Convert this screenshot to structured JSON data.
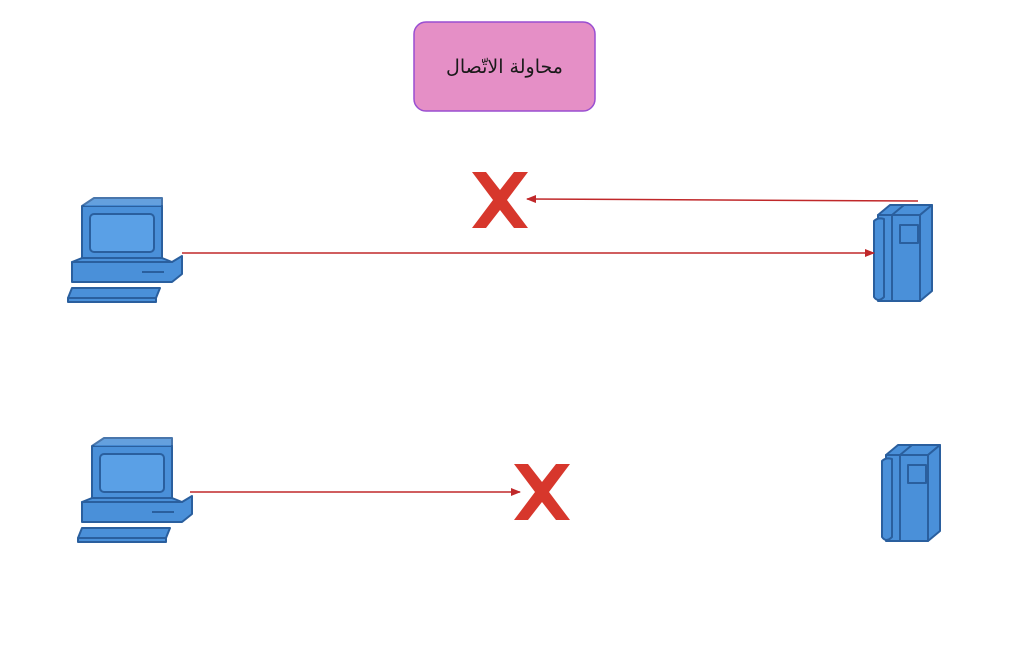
{
  "title": {
    "text": "محاولة الاتّصال",
    "fill": "#E58FC6",
    "border": "#9A4FD1",
    "text_color": "#1A1A1A"
  },
  "colors": {
    "device_fill": "#4A90D9",
    "device_stroke": "#2A5F9E",
    "screen_fill": "#5AA0E6",
    "arrow": "#C0282A",
    "x_mark": "#D7372C"
  },
  "icons": {
    "client": "computer-icon",
    "server": "server-tower-icon",
    "failure": "x-mark-icon"
  },
  "scenarios": [
    {
      "name": "server-reply-fails",
      "request": "client-to-server",
      "reply": "server-to-client",
      "failure_at": "reply"
    },
    {
      "name": "request-fails",
      "request": "client-to-server",
      "failure_at": "request"
    }
  ]
}
